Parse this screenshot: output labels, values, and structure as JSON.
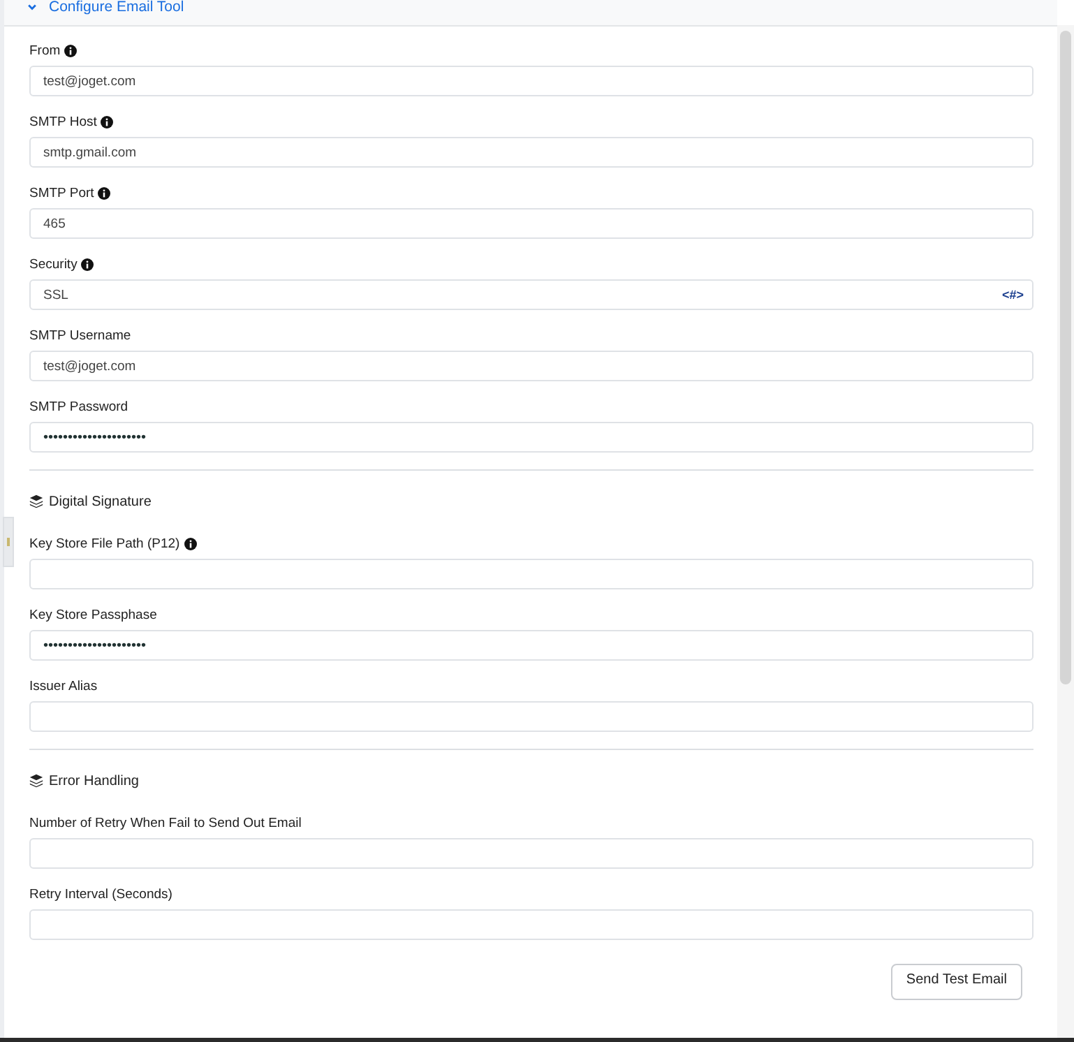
{
  "header": {
    "title": "Configure Email Tool",
    "expanded": true
  },
  "items": [
    {
      "kind": "field",
      "label": "From",
      "info": true,
      "value": "test@joget.com"
    },
    {
      "kind": "field",
      "label": "SMTP Host",
      "info": true,
      "value": "smtp.gmail.com"
    },
    {
      "kind": "field",
      "label": "SMTP Port",
      "info": true,
      "value": "465"
    },
    {
      "kind": "select",
      "label": "Security",
      "info": true,
      "value": "SSL",
      "glyph": "<#>"
    },
    {
      "kind": "field",
      "label": "SMTP Username",
      "info": false,
      "value": "test@joget.com"
    },
    {
      "kind": "password",
      "label": "SMTP Password",
      "info": false,
      "value": "•••••••••••••••••••••"
    },
    {
      "kind": "section",
      "label": "Digital Signature"
    },
    {
      "kind": "field",
      "label": "Key Store File Path (P12)",
      "info": true
    },
    {
      "kind": "password",
      "label": "Key Store Passphase",
      "info": false,
      "value": "•••••••••••••••••••••"
    },
    {
      "kind": "field",
      "label": "Issuer Alias",
      "info": false
    },
    {
      "kind": "section",
      "label": "Error Handling"
    },
    {
      "kind": "field",
      "label": "Number of Retry When Fail to Send Out Email",
      "info": false
    },
    {
      "kind": "field",
      "label": "Retry Interval (Seconds)",
      "info": false
    }
  ],
  "button": "Send Test Email"
}
